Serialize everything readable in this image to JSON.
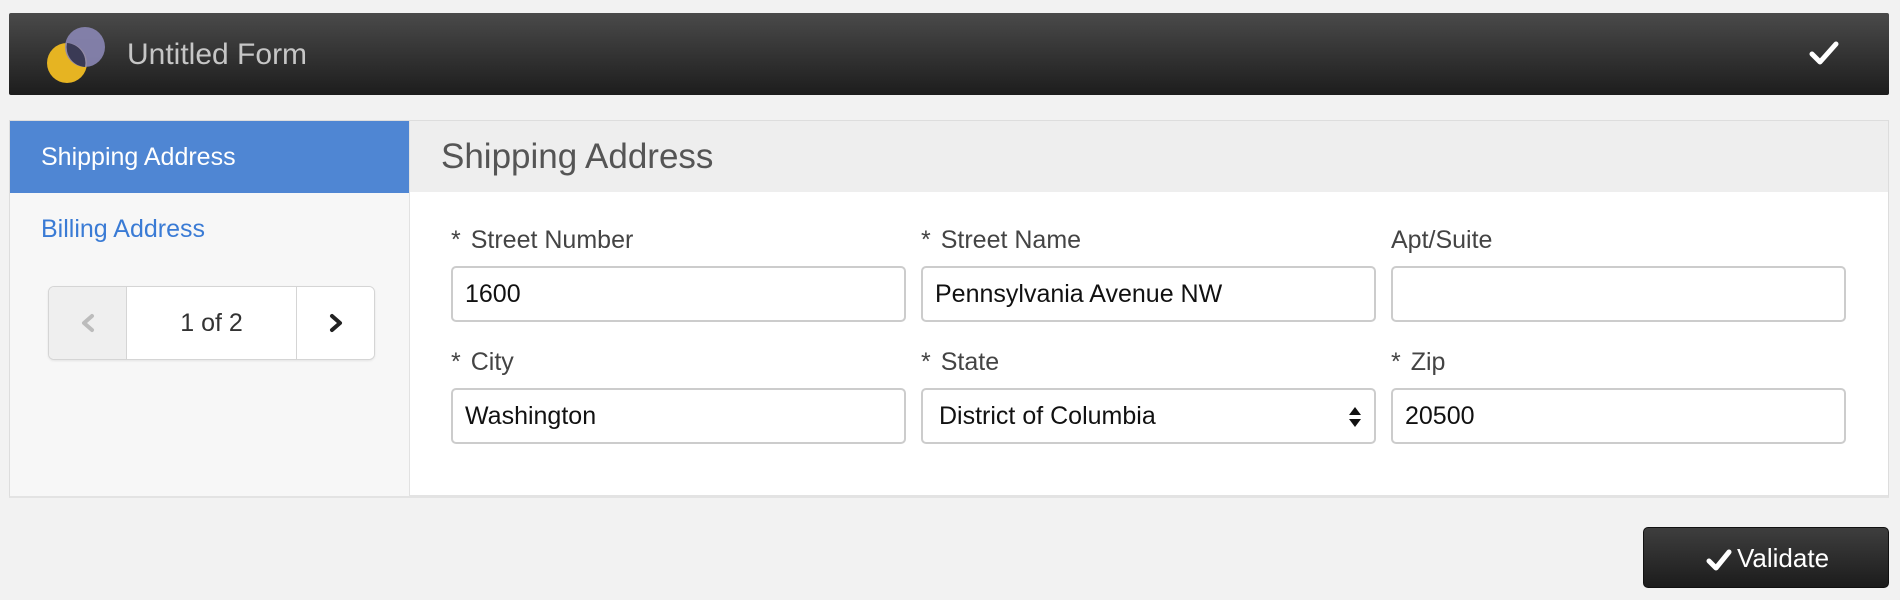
{
  "header": {
    "title": "Untitled Form",
    "logo_icon": "app-logo-circles",
    "confirm_icon": "checkmark-icon",
    "bar_color": "#2b2b2b"
  },
  "sidebar": {
    "items": [
      {
        "label": "Shipping Address",
        "active": true
      },
      {
        "label": "Billing Address",
        "active": false
      }
    ],
    "pager": {
      "label": "1 of 2",
      "prev_icon": "chevron-left-icon",
      "next_icon": "chevron-right-icon"
    },
    "active_color": "#4f86d3",
    "link_color": "#3a7bd5"
  },
  "section": {
    "title": "Shipping Address",
    "fields": {
      "street_number": {
        "label": "Street Number",
        "required": "*",
        "value": "1600"
      },
      "street_name": {
        "label": "Street Name",
        "required": "*",
        "value": "Pennsylvania Avenue NW"
      },
      "apt_suite": {
        "label": "Apt/Suite",
        "value": ""
      },
      "city": {
        "label": "City",
        "required": "*",
        "value": "Washington"
      },
      "state": {
        "label": "State",
        "required": "*",
        "value": "District of Columbia"
      },
      "zip": {
        "label": "Zip",
        "required": "*",
        "value": "20500"
      }
    }
  },
  "footer": {
    "validate_label": "Validate",
    "validate_icon": "checkmark-icon"
  }
}
